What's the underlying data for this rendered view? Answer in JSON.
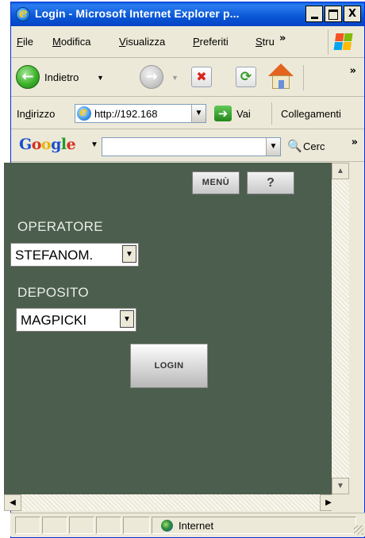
{
  "window": {
    "title": "Login - Microsoft Internet Explorer p...",
    "controls": {
      "minimize": "_",
      "maximize": "□",
      "close": "X"
    }
  },
  "menubar": {
    "items": [
      {
        "label": "File",
        "accel": "F",
        "rest": "ile"
      },
      {
        "label": "Modifica",
        "accel": "M",
        "rest": "odifica"
      },
      {
        "label": "Visualizza",
        "accel": "V",
        "rest": "isualizza"
      },
      {
        "label": "Preferiti",
        "accel": "P",
        "rest": "referiti"
      },
      {
        "label": "Stru",
        "accel": "S",
        "rest": "tru"
      }
    ],
    "overflow": "»"
  },
  "toolbar": {
    "back_label": "Indietro",
    "overflow": "»"
  },
  "addressbar": {
    "label_pre": "In",
    "label_accel": "d",
    "label_post": "irizzo",
    "url": "http://192.168",
    "go_label": "Vai",
    "links_label": "Collegamenti"
  },
  "googlebar": {
    "logo": {
      "g1": "G",
      "o1": "o",
      "o2": "o",
      "g2": "g",
      "l": "l",
      "e": "e"
    },
    "search_value": "",
    "search_label": "Cerc",
    "overflow": "»"
  },
  "content": {
    "menu_button": "MENÙ",
    "help_button": "?",
    "operator_label": "OPERATORE",
    "operator_value": "STEFANOM.",
    "warehouse_label": "DEPOSITO",
    "warehouse_value": "MAGPICKI",
    "login_button": "LOGIN",
    "background_color": "#4c5e4d"
  },
  "statusbar": {
    "zone_label": "Internet"
  }
}
